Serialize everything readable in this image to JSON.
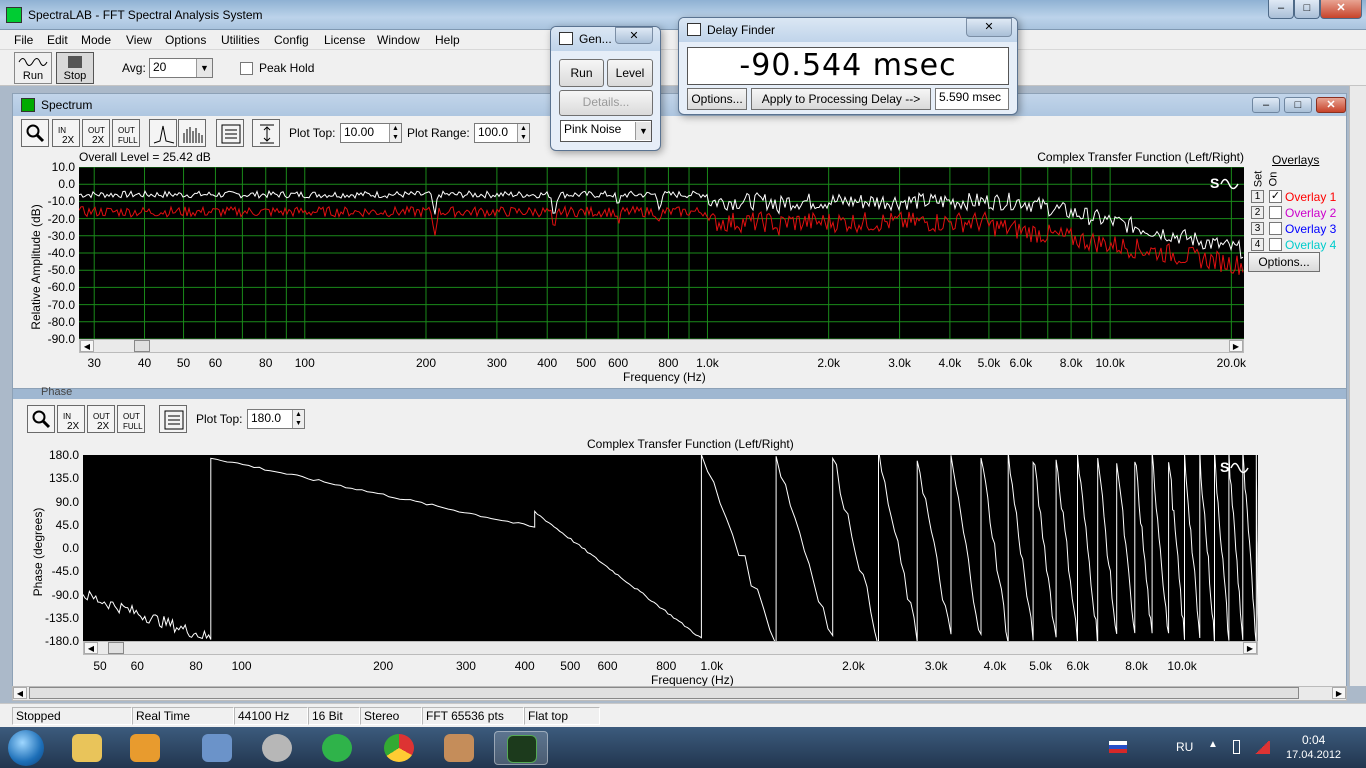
{
  "window": {
    "title": "SpectraLAB - FFT Spectral Analysis System"
  },
  "menu": [
    "File",
    "Edit",
    "Mode",
    "View",
    "Options",
    "Utilities",
    "Config",
    "License",
    "Window",
    "Help"
  ],
  "toolbar": {
    "run_label": "Run",
    "stop_label": "Stop",
    "avg_label": "Avg:",
    "avg_value": "20",
    "peak_hold_label": "Peak Hold"
  },
  "spectrum": {
    "title": "Spectrum",
    "plot_top_label": "Plot Top:",
    "plot_top_value": "10.00",
    "plot_range_label": "Plot Range:",
    "plot_range_value": "100.0",
    "overall_level": "Overall Level = 25.42 dB",
    "header_right": "Complex Transfer Function (Left/Right)",
    "ylabel": "Relative Amplitude (dB)",
    "xlabel": "Frequency (Hz)",
    "yticks": [
      "10.0",
      "0.0",
      "-10.0",
      "-20.0",
      "-30.0",
      "-40.0",
      "-50.0",
      "-60.0",
      "-70.0",
      "-80.0",
      "-90.0"
    ],
    "xticks": [
      "30",
      "40",
      "50",
      "60",
      "80",
      "100",
      "200",
      "300",
      "400",
      "500",
      "600",
      "800",
      "1.0k",
      "2.0k",
      "3.0k",
      "4.0k",
      "5.0k",
      "6.0k",
      "8.0k",
      "10.0k",
      "20.0k"
    ],
    "overlays_title": "Overlays",
    "set_label": "Set",
    "on_label": "On",
    "overlays": [
      {
        "num": "1",
        "label": "Overlay 1",
        "checked": true,
        "color": "#ff0000"
      },
      {
        "num": "2",
        "label": "Overlay 2",
        "checked": false,
        "color": "#cc00cc"
      },
      {
        "num": "3",
        "label": "Overlay 3",
        "checked": false,
        "color": "#0000ff"
      },
      {
        "num": "4",
        "label": "Overlay 4",
        "checked": false,
        "color": "#00cccc"
      }
    ],
    "options_label": "Options..."
  },
  "phase": {
    "title": "Phase",
    "plot_top_label": "Plot Top:",
    "plot_top_value": "180.0",
    "header": "Complex Transfer Function (Left/Right)",
    "ylabel": "Phase (degrees)",
    "xlabel": "Frequency (Hz)",
    "yticks": [
      "180.0",
      "135.0",
      "90.0",
      "45.0",
      "0.0",
      "-45.0",
      "-90.0",
      "-135.0",
      "-180.0"
    ],
    "xticks": [
      "50",
      "60",
      "80",
      "100",
      "200",
      "300",
      "400",
      "500",
      "600",
      "800",
      "1.0k",
      "2.0k",
      "3.0k",
      "4.0k",
      "5.0k",
      "6.0k",
      "8.0k",
      "10.0k"
    ]
  },
  "generator": {
    "title": "Gen...",
    "run_label": "Run",
    "level_label": "Level",
    "details_label": "Details...",
    "signal_value": "Pink Noise"
  },
  "delay_finder": {
    "title": "Delay Finder",
    "readout": "-90.544 msec",
    "options_label": "Options...",
    "apply_label": "Apply to Processing Delay -->",
    "delay_value": "5.590 msec"
  },
  "statusbar": [
    "Stopped",
    "Real Time",
    "44100 Hz",
    "16 Bit",
    "Stereo",
    "FFT 65536 pts",
    "Flat top"
  ],
  "taskbar": {
    "lang": "RU",
    "time": "0:04",
    "date": "17.04.2012"
  },
  "colors": {
    "trace_white": "#ffffff",
    "trace_red": "#e01010",
    "grid": "#1a8a1a"
  }
}
